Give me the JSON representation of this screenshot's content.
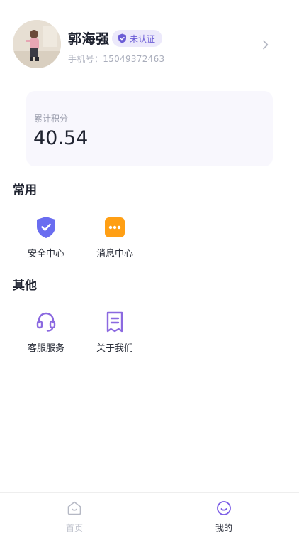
{
  "profile": {
    "name": "郭海强",
    "badge": "未认证",
    "phone": "手机号：15049372463"
  },
  "points": {
    "label": "累计积分",
    "value": "40.54"
  },
  "sections": {
    "common_title": "常用",
    "common_items": [
      {
        "label": "安全中心",
        "icon": "shield-check-icon",
        "color": "#6a6df0"
      },
      {
        "label": "消息中心",
        "icon": "message-dots-icon",
        "color": "#ff9f14"
      }
    ],
    "other_title": "其他",
    "other_items": [
      {
        "label": "客服服务",
        "icon": "headset-icon",
        "color": "#8b69e0"
      },
      {
        "label": "关于我们",
        "icon": "receipt-icon",
        "color": "#8b69e0"
      }
    ]
  },
  "tabbar": {
    "tabs": [
      {
        "label": "首页",
        "icon": "home-icon",
        "active": false
      },
      {
        "label": "我的",
        "icon": "smile-icon",
        "active": true
      }
    ]
  },
  "colors": {
    "accent": "#7b5ce6",
    "inactive": "#b5b8c4"
  }
}
